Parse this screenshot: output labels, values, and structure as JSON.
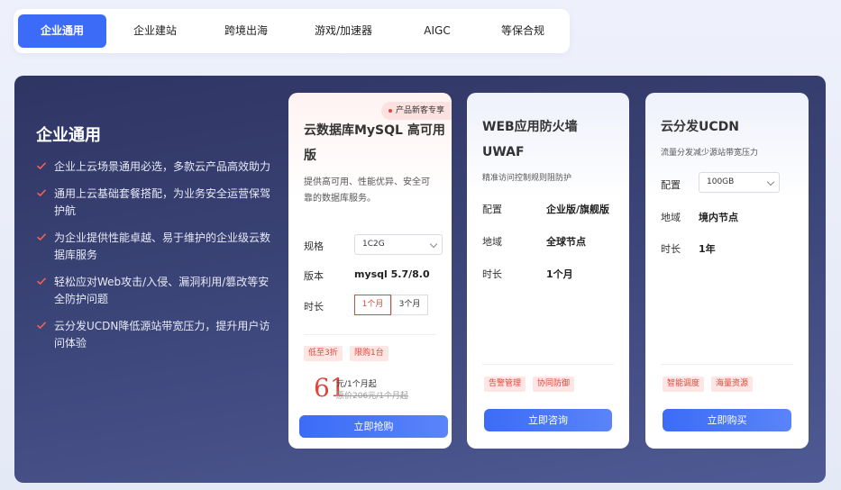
{
  "tabs": [
    {
      "label": "企业通用",
      "active": true
    },
    {
      "label": "企业建站",
      "active": false
    },
    {
      "label": "跨境出海",
      "active": false
    },
    {
      "label": "游戏/加速器",
      "active": false
    },
    {
      "label": "AIGC",
      "active": false
    },
    {
      "label": "等保合规",
      "active": false
    }
  ],
  "intro": {
    "title": "企业通用",
    "features": [
      "企业上云场景通用必选，多款云产品高效助力",
      "通用上云基础套餐搭配，为业务安全运营保驾护航",
      "为企业提供性能卓越、易于维护的企业级云数据库服务",
      "轻松应对Web攻击/入侵、漏洞利用/篡改等安全防护问题",
      "云分发UCDN降低源站带宽压力，提升用户访问体验"
    ]
  },
  "cards": [
    {
      "badge": "产品新客专享",
      "title_line1": "云数据库MySQL 高可用",
      "title_line2": "版",
      "desc_line1": "提供高可用、性能优异、安全可",
      "desc_line2": "靠的数据库服务。",
      "spec_label": "规格",
      "spec_value": "1C2G",
      "version_label": "版本",
      "version_value": "mysql 5.7/8.0",
      "duration_label": "时长",
      "duration_options": [
        "1个月",
        "3个月"
      ],
      "duration_selected": "1个月",
      "tags": [
        "低至3折",
        "限购1台"
      ],
      "price": "61",
      "price_unit": "元/1个月起",
      "price_original": "原价206元/1个月起",
      "cta": "立即抢购"
    },
    {
      "title_line1": "WEB应用防火墙",
      "title_line2": "UWAF",
      "desc": "精准访问控制规则阻防护",
      "config_label": "配置",
      "config_value": "企业版/旗舰版",
      "region_label": "地域",
      "region_value": "全球节点",
      "duration_label": "时长",
      "duration_value": "1个月",
      "tags": [
        "告警管理",
        "协同防御"
      ],
      "cta": "立即咨询"
    },
    {
      "title": "云分发UCDN",
      "desc": "流量分发减少源站带宽压力",
      "config_label": "配置",
      "config_value": "100GB",
      "region_label": "地域",
      "region_value": "境内节点",
      "duration_label": "时长",
      "duration_value": "1年",
      "tags": [
        "智能调度",
        "海量资源"
      ],
      "cta": "立即购买"
    }
  ],
  "colors": {
    "accent": "#3c6cf7",
    "danger": "#e0463b",
    "panel_dark": "#2f3563"
  }
}
